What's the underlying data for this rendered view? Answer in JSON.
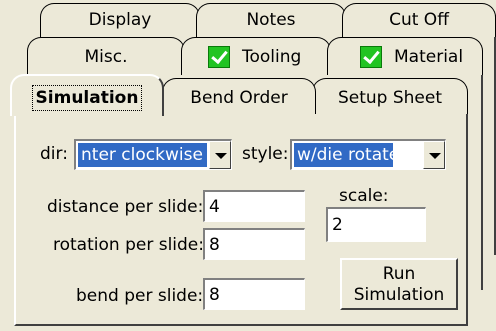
{
  "tabs": {
    "row1": [
      {
        "label": "Display"
      },
      {
        "label": "Notes"
      },
      {
        "label": "Cut Off"
      }
    ],
    "row2": [
      {
        "label": "Misc.",
        "checked": false
      },
      {
        "label": "Tooling",
        "checked": true
      },
      {
        "label": "Material",
        "checked": true
      }
    ],
    "row3": [
      {
        "label": "Simulation",
        "selected": true
      },
      {
        "label": "Bend Order"
      },
      {
        "label": "Setup Sheet"
      }
    ]
  },
  "simulation": {
    "dir_label": "dir:",
    "dir_value": "nter clockwise",
    "style_label": "style:",
    "style_value": "w/die rotate",
    "distance_label": "distance per slide:",
    "distance_value": "4",
    "rotation_label": "rotation per slide:",
    "rotation_value": "8",
    "bend_label": "bend per slide:",
    "bend_value": "8",
    "scale_label": "scale:",
    "scale_value": "2",
    "run_button": "Run\nSimulation"
  },
  "colors": {
    "window_bg": "#ece9d8",
    "selection": "#316ac5",
    "checkmark": "#22c422"
  }
}
